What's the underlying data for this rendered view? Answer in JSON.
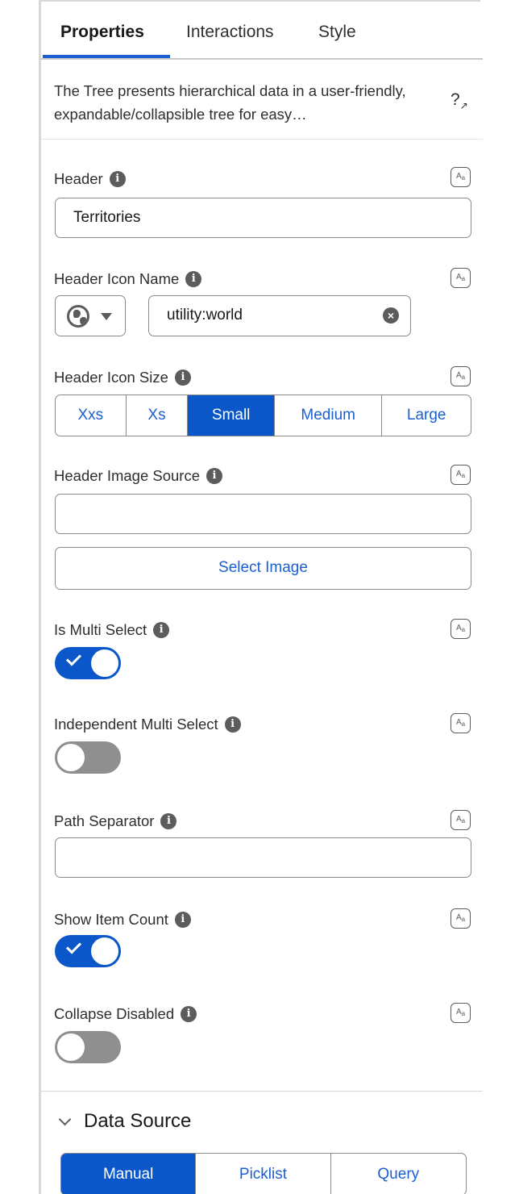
{
  "tabs": [
    {
      "label": "Properties",
      "active": true
    },
    {
      "label": "Interactions",
      "active": false
    },
    {
      "label": "Style",
      "active": false
    }
  ],
  "description": {
    "text": "The Tree presents hierarchical data in a user-friendly, expandable/collapsible tree for easy…",
    "help_icon": "help-expand-icon"
  },
  "fields": {
    "header": {
      "label": "Header",
      "value": "Territories"
    },
    "header_icon_name": {
      "label": "Header Icon Name",
      "value": "utility:world",
      "icon": "globe-icon"
    },
    "header_icon_size": {
      "label": "Header Icon Size",
      "options": [
        "Xxs",
        "Xs",
        "Small",
        "Medium",
        "Large"
      ],
      "selected": "Small"
    },
    "header_image_source": {
      "label": "Header Image Source",
      "value": "",
      "button_label": "Select Image"
    },
    "is_multi_select": {
      "label": "Is Multi Select",
      "on": true
    },
    "independent_multi_select": {
      "label": "Independent Multi Select",
      "on": false
    },
    "path_separator": {
      "label": "Path Separator",
      "value": ""
    },
    "show_item_count": {
      "label": "Show Item Count",
      "on": true
    },
    "collapse_disabled": {
      "label": "Collapse Disabled",
      "on": false
    }
  },
  "data_source": {
    "title": "Data Source",
    "options": [
      "Manual",
      "Picklist",
      "Query"
    ],
    "selected": "Manual"
  },
  "colors": {
    "accent": "#0b57c9",
    "link": "#1b5fd1",
    "toggle_off": "#8f8f8f"
  }
}
